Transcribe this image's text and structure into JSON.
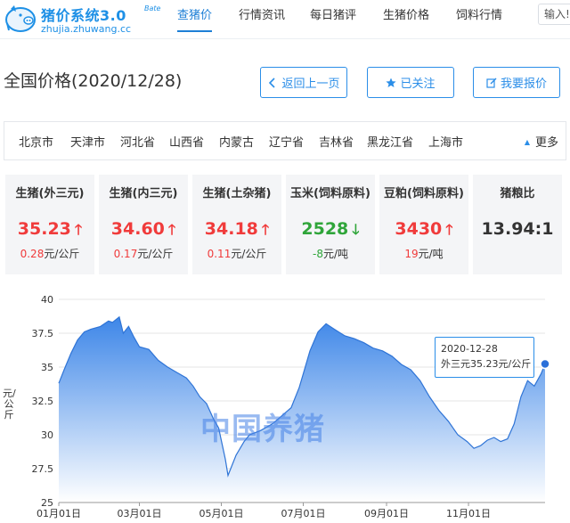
{
  "header": {
    "logo_title": "猪价系统3.0",
    "logo_beta": "Bate",
    "logo_sub": "zhujia.zhuwang.cc",
    "nav": [
      "查猪价",
      "行情资讯",
      "每日猪评",
      "生猪价格",
      "饲料行情"
    ],
    "active_nav": 0,
    "search_placeholder": "输入!"
  },
  "page": {
    "title": "全国价格(2020/12/28)",
    "buttons": {
      "back": "返回上一页",
      "follow": "已关注",
      "report": "我要报价"
    }
  },
  "regions": {
    "items": [
      "北京市",
      "天津市",
      "河北省",
      "山西省",
      "内蒙古",
      "辽宁省",
      "吉林省",
      "黑龙江省",
      "上海市"
    ],
    "more": "更多"
  },
  "cards": [
    {
      "title": "生猪(外三元)",
      "price": "35.23",
      "direction": "up",
      "change": "0.28",
      "unit": "元/公斤"
    },
    {
      "title": "生猪(内三元)",
      "price": "34.60",
      "direction": "up",
      "change": "0.17",
      "unit": "元/公斤"
    },
    {
      "title": "生猪(土杂猪)",
      "price": "34.18",
      "direction": "up",
      "change": "0.11",
      "unit": "元/公斤"
    },
    {
      "title": "玉米(饲料原料)",
      "price": "2528",
      "direction": "down",
      "change": "-8",
      "unit": "元/吨"
    },
    {
      "title": "豆粕(饲料原料)",
      "price": "3430",
      "direction": "up",
      "change": "19",
      "unit": "元/吨"
    },
    {
      "title": "猪粮比",
      "price": "13.94:1",
      "direction": "neutral",
      "change": "",
      "unit": ""
    }
  ],
  "colors": {
    "accent": "#2b8ee8",
    "up": "#f03b3b",
    "down": "#2fa53a",
    "area_top": "#3d86e8",
    "area_bottom": "#ffffff"
  },
  "chart_data": {
    "type": "area",
    "ylabel": "元/公斤",
    "ylim": [
      25,
      40
    ],
    "yticks": [
      25,
      27.5,
      30,
      32.5,
      35,
      37.5,
      40
    ],
    "x_range": [
      "2020-01-01",
      "2020-12-28"
    ],
    "xticks": [
      "01月01日",
      "03月01日",
      "05月01日",
      "07月01日",
      "09月01日",
      "11月01日"
    ],
    "watermark": "中国养猪",
    "tooltip": {
      "date": "2020-12-28",
      "label": "外三元35.23元/公斤"
    },
    "series": [
      {
        "x": [
          "2020-01-01",
          "2020-01-05",
          "2020-01-10",
          "2020-01-15",
          "2020-01-20",
          "2020-01-25",
          "2020-02-01",
          "2020-02-07",
          "2020-02-10",
          "2020-02-15",
          "2020-02-18",
          "2020-02-22",
          "2020-02-26",
          "2020-03-01",
          "2020-03-08",
          "2020-03-15",
          "2020-03-22",
          "2020-03-29",
          "2020-04-05",
          "2020-04-10",
          "2020-04-15",
          "2020-04-20",
          "2020-04-25",
          "2020-04-29",
          "2020-05-04",
          "2020-05-06",
          "2020-05-12",
          "2020-05-18",
          "2020-05-22",
          "2020-05-30",
          "2020-06-08",
          "2020-06-15",
          "2020-06-22",
          "2020-06-28",
          "2020-07-01",
          "2020-07-06",
          "2020-07-12",
          "2020-07-18",
          "2020-07-24",
          "2020-08-01",
          "2020-08-08",
          "2020-08-15",
          "2020-08-22",
          "2020-08-29",
          "2020-09-05",
          "2020-09-12",
          "2020-09-19",
          "2020-09-26",
          "2020-10-03",
          "2020-10-10",
          "2020-10-17",
          "2020-10-24",
          "2020-10-31",
          "2020-11-05",
          "2020-11-10",
          "2020-11-15",
          "2020-11-20",
          "2020-11-25",
          "2020-11-30",
          "2020-12-05",
          "2020-12-10",
          "2020-12-15",
          "2020-12-20",
          "2020-12-25",
          "2020-12-28"
        ],
        "values": [
          33.8,
          34.8,
          36.0,
          37.0,
          37.6,
          37.8,
          38.0,
          38.4,
          38.3,
          38.7,
          37.5,
          38.0,
          37.2,
          36.5,
          36.3,
          35.5,
          35.0,
          34.6,
          34.2,
          33.6,
          32.8,
          32.3,
          31.2,
          30.5,
          28.2,
          27.0,
          28.5,
          29.5,
          30.0,
          30.3,
          30.8,
          31.4,
          32.0,
          33.5,
          34.5,
          36.2,
          37.6,
          38.2,
          37.8,
          37.3,
          37.1,
          36.8,
          36.4,
          36.2,
          35.8,
          35.2,
          34.8,
          34.0,
          32.8,
          31.8,
          31.0,
          30.0,
          29.5,
          29.0,
          29.2,
          29.6,
          29.8,
          29.5,
          29.7,
          30.8,
          32.8,
          34.0,
          33.6,
          34.5,
          35.23
        ]
      }
    ]
  }
}
